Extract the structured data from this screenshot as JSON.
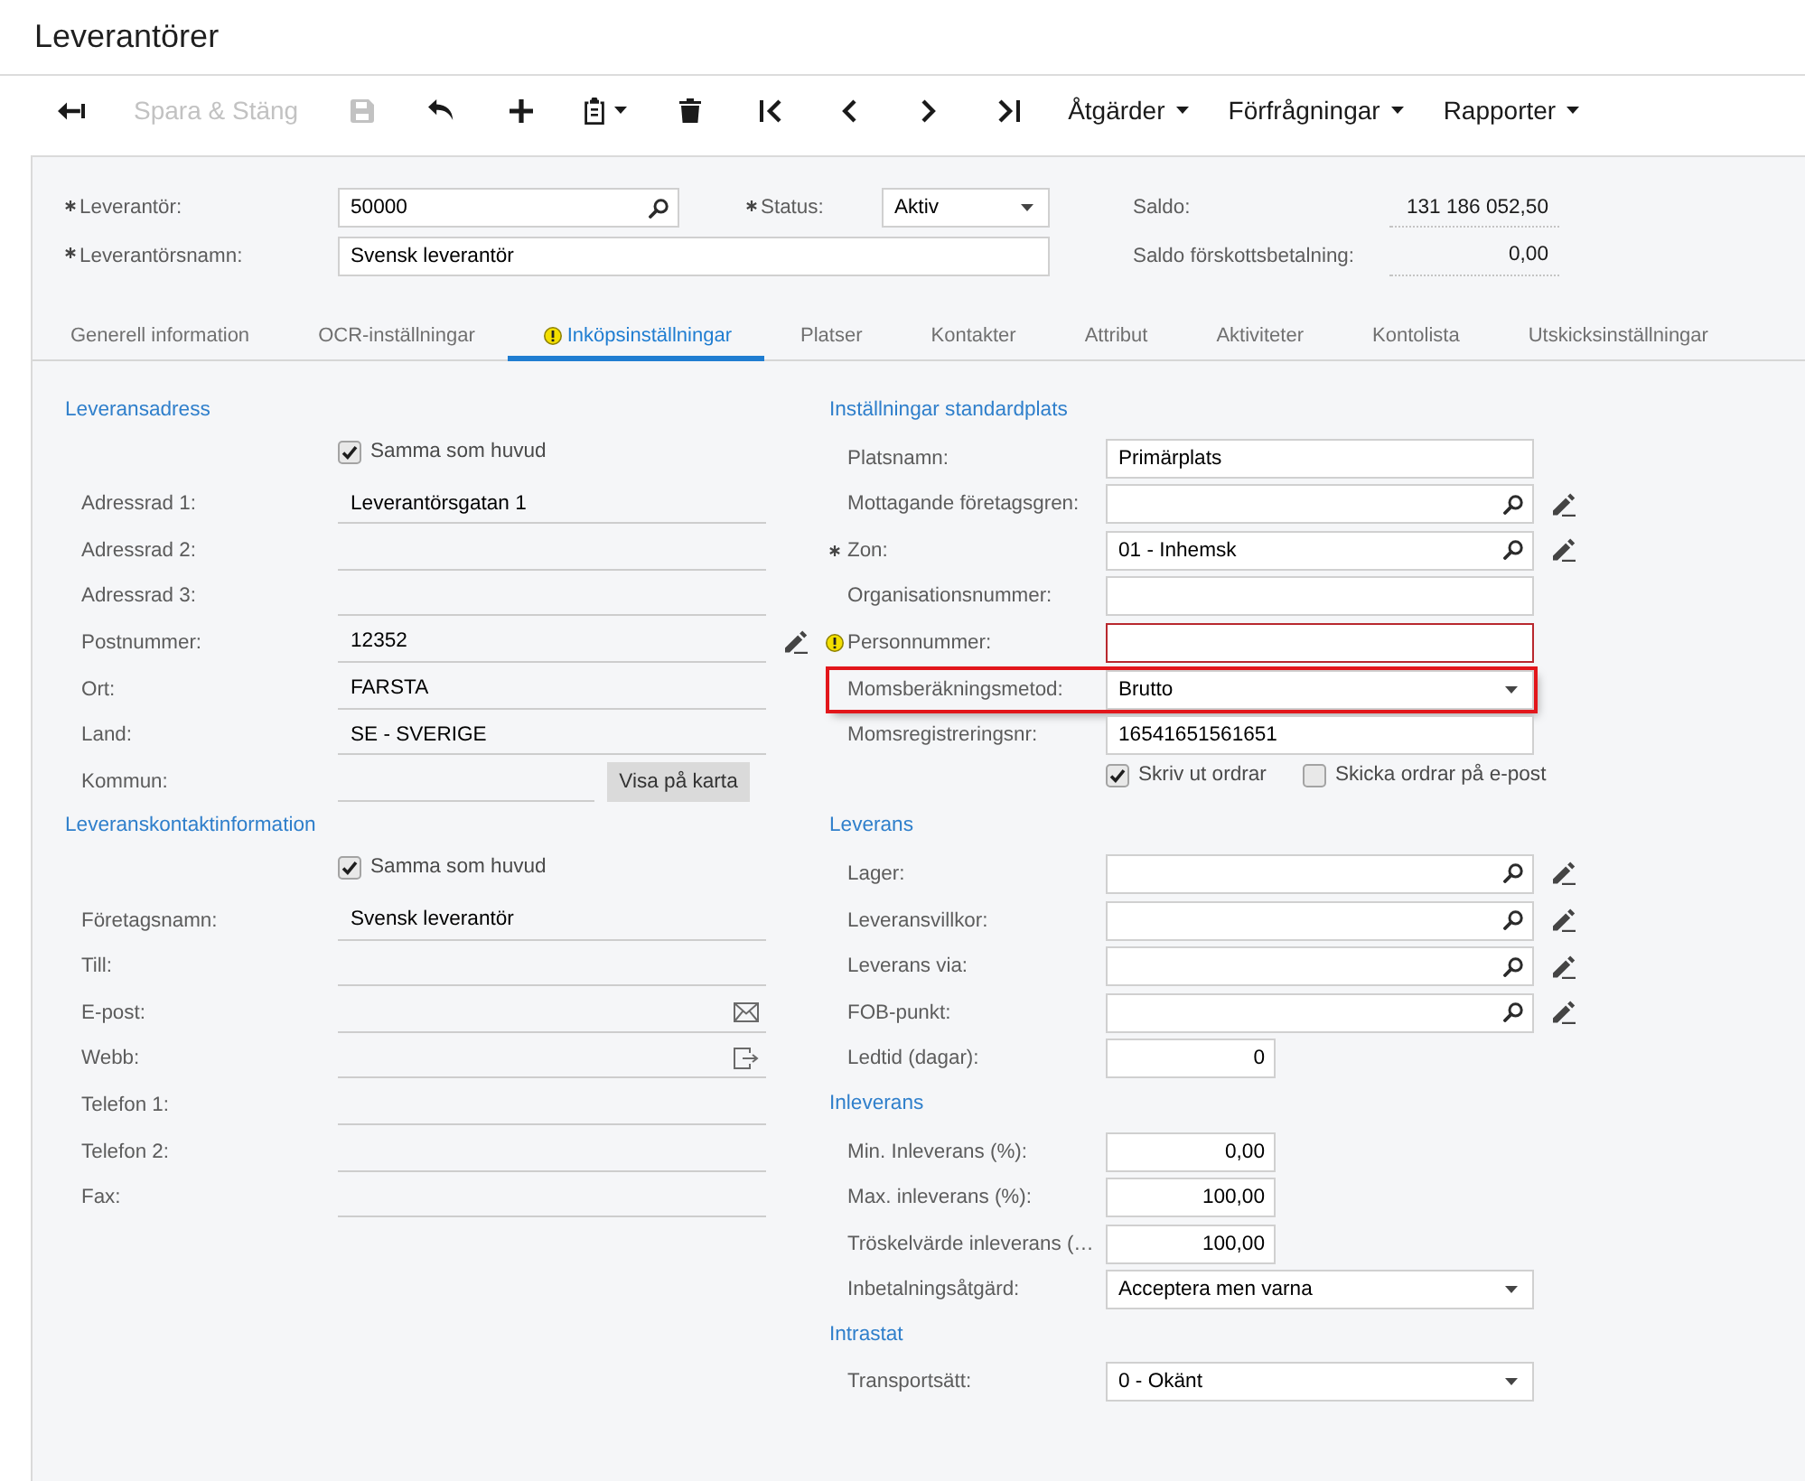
{
  "page": {
    "title": "Leverantörer"
  },
  "toolbar": [
    {
      "kind": "icon",
      "disabled": false
    },
    {
      "kind": "text",
      "label": "Spara & Stäng",
      "disabled": true
    },
    {
      "kind": "icon",
      "disabled": true
    },
    {
      "kind": "icon",
      "disabled": false
    },
    {
      "kind": "icon",
      "disabled": false
    },
    {
      "kind": "iconmenu",
      "disabled": false
    },
    {
      "kind": "icon",
      "disabled": false
    },
    {
      "kind": "icon",
      "disabled": false
    },
    {
      "kind": "icon",
      "disabled": false
    },
    {
      "kind": "icon",
      "disabled": false
    },
    {
      "kind": "icon",
      "disabled": false
    },
    {
      "kind": "menu",
      "label": "Åtgärder",
      "disabled": false
    },
    {
      "kind": "menu",
      "label": "Förfrågningar",
      "disabled": false
    },
    {
      "kind": "menu",
      "label": "Rapporter",
      "disabled": false
    }
  ],
  "header": {
    "rows": [
      {
        "fields": [
          {
            "label": "Leverantör:",
            "required": true,
            "kind": "lookup",
            "value": "50000"
          },
          {
            "label": "Status:",
            "required": true,
            "kind": "select",
            "value": "Aktiv"
          }
        ],
        "balance": {
          "label": "Saldo:",
          "value": "131 186 052,50"
        }
      },
      {
        "fields": [
          {
            "label": "Leverantörsnamn:",
            "required": true,
            "kind": "text",
            "value": "Svensk leverantör"
          }
        ],
        "balance": {
          "label": "Saldo förskottsbetalning:",
          "value": "0,00"
        }
      }
    ]
  },
  "tabs": [
    {
      "label": "Generell information",
      "selected": false,
      "warning": false
    },
    {
      "label": "OCR-inställningar",
      "selected": false,
      "warning": false
    },
    {
      "label": "Inköpsinställningar",
      "selected": true,
      "warning": true
    },
    {
      "label": "Platser",
      "selected": false,
      "warning": false
    },
    {
      "label": "Kontakter",
      "selected": false,
      "warning": false
    },
    {
      "label": "Attribut",
      "selected": false,
      "warning": false
    },
    {
      "label": "Aktiviteter",
      "selected": false,
      "warning": false
    },
    {
      "label": "Kontolista",
      "selected": false,
      "warning": false
    },
    {
      "label": "Utskicksinställningar",
      "selected": false,
      "warning": false
    }
  ],
  "left_sections": [
    {
      "title": "Leveransadress",
      "same_as_main": {
        "label": "Samma som huvud",
        "checked": true
      },
      "rows": [
        {
          "label": "Adressrad 1:",
          "kind": "text",
          "value": "Leverantörsgatan 1"
        },
        {
          "label": "Adressrad 2:",
          "kind": "text"
        },
        {
          "label": "Adressrad 3:",
          "kind": "text"
        },
        {
          "label": "Postnummer:",
          "kind": "text-edit",
          "value": "12352"
        },
        {
          "label": "Ort:",
          "kind": "text",
          "value": "FARSTA"
        },
        {
          "label": "Land:",
          "kind": "text",
          "value": "SE - SVERIGE"
        },
        {
          "label": "Kommun:",
          "kind": "map",
          "button": "Visa på karta"
        }
      ]
    },
    {
      "title": "Leveranskontaktinformation",
      "same_as_main": {
        "label": "Samma som huvud",
        "checked": true
      },
      "rows": [
        {
          "label": "Företagsnamn:",
          "kind": "text",
          "value": "Svensk leverantör"
        },
        {
          "label": "Till:",
          "kind": "text"
        },
        {
          "label": "E-post:",
          "kind": "email"
        },
        {
          "label": "Webb:",
          "kind": "web"
        },
        {
          "label": "Telefon 1:",
          "kind": "text"
        },
        {
          "label": "Telefon 2:",
          "kind": "text"
        },
        {
          "label": "Fax:",
          "kind": "text"
        }
      ]
    }
  ],
  "right_sections": [
    {
      "title": "Inställningar standardplats",
      "rows": [
        {
          "label": "Platsnamn:",
          "kind": "text",
          "value": "Primärplats",
          "required": false,
          "error": false,
          "highlighted": false
        },
        {
          "label": "Mottagande företagsgren:",
          "kind": "lookup",
          "required": false,
          "error": false,
          "highlighted": false
        },
        {
          "label": "Zon:",
          "kind": "lookup",
          "value": "01 - Inhemsk",
          "required": true,
          "error": false,
          "highlighted": false
        },
        {
          "label": "Organisationsnummer:",
          "kind": "text",
          "required": false,
          "error": false,
          "highlighted": false
        },
        {
          "label": "Personnummer:",
          "kind": "text",
          "required": false,
          "error": true,
          "highlighted": false
        },
        {
          "label": "Momsberäkningsmetod:",
          "kind": "select",
          "value": "Brutto",
          "required": false,
          "error": false,
          "highlighted": true
        },
        {
          "label": "Momsregistreringsnr:",
          "kind": "text",
          "value": "16541651561651",
          "required": false,
          "error": false,
          "highlighted": false
        },
        {
          "kind": "checkboxes",
          "options": [
            {
              "label": "Skriv ut ordrar",
              "checked": true
            },
            {
              "label": "Skicka ordrar på e-post",
              "checked": false
            }
          ],
          "required": false,
          "error": false,
          "highlighted": false
        }
      ]
    },
    {
      "title": "Leverans",
      "rows": [
        {
          "label": "Lager:",
          "kind": "lookup",
          "required": false,
          "error": false,
          "highlighted": false
        },
        {
          "label": "Leveransvillkor:",
          "kind": "lookup",
          "required": false,
          "error": false,
          "highlighted": false
        },
        {
          "label": "Leverans via:",
          "kind": "lookup",
          "required": false,
          "error": false,
          "highlighted": false
        },
        {
          "label": "FOB-punkt:",
          "kind": "lookup",
          "required": false,
          "error": false,
          "highlighted": false
        },
        {
          "label": "Ledtid (dagar):",
          "kind": "number",
          "value": "0",
          "required": false,
          "error": false,
          "highlighted": false
        }
      ]
    },
    {
      "title": "Inleverans",
      "rows": [
        {
          "label": "Min. Inleverans (%):",
          "kind": "number",
          "value": "0,00",
          "required": false,
          "error": false,
          "highlighted": false
        },
        {
          "label": "Max. inleverans (%):",
          "kind": "number",
          "value": "100,00",
          "required": false,
          "error": false,
          "highlighted": false
        },
        {
          "label": "Tröskelvärde inleverans (…",
          "kind": "number",
          "value": "100,00",
          "required": false,
          "error": false,
          "highlighted": false
        },
        {
          "label": "Inbetalningsåtgärd:",
          "kind": "select",
          "value": "Acceptera men varna",
          "required": false,
          "error": false,
          "highlighted": false
        }
      ]
    },
    {
      "title": "Intrastat",
      "rows": [
        {
          "label": "Transportsätt:",
          "kind": "select",
          "value": "0 - Okänt",
          "required": false,
          "error": false,
          "highlighted": false
        }
      ]
    }
  ]
}
